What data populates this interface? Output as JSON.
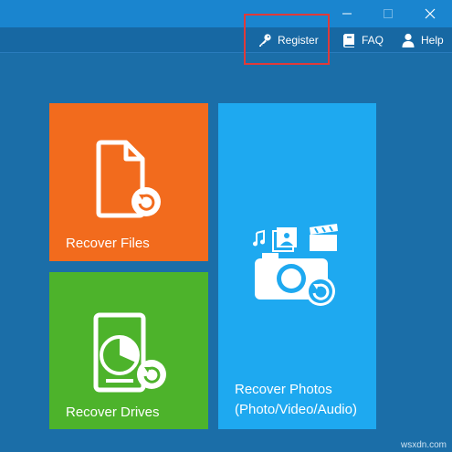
{
  "window": {
    "controls": [
      {
        "name": "minimize-button",
        "icon": "minimize-icon"
      },
      {
        "name": "maximize-button",
        "icon": "maximize-icon"
      },
      {
        "name": "close-button",
        "icon": "close-icon"
      }
    ]
  },
  "toolbar": {
    "register_label": "Register",
    "faq_label": "FAQ",
    "help_label": "Help"
  },
  "tiles": {
    "recover_files": {
      "label": "Recover Files",
      "color": "#f26b1d",
      "icon": "file-recover-icon"
    },
    "recover_drives": {
      "label": "Recover Drives",
      "color": "#4db32b",
      "icon": "drive-recover-icon"
    },
    "recover_photos": {
      "label_line1": "Recover Photos",
      "label_line2": "(Photo/Video/Audio)",
      "color": "#1ea9f0",
      "icon": "camera-recover-icon"
    }
  },
  "colors": {
    "background": "#1b6ea8",
    "titlebar": "#1a85cf",
    "highlight_border": "#e03a3a"
  },
  "watermark": "wsxdn.com"
}
